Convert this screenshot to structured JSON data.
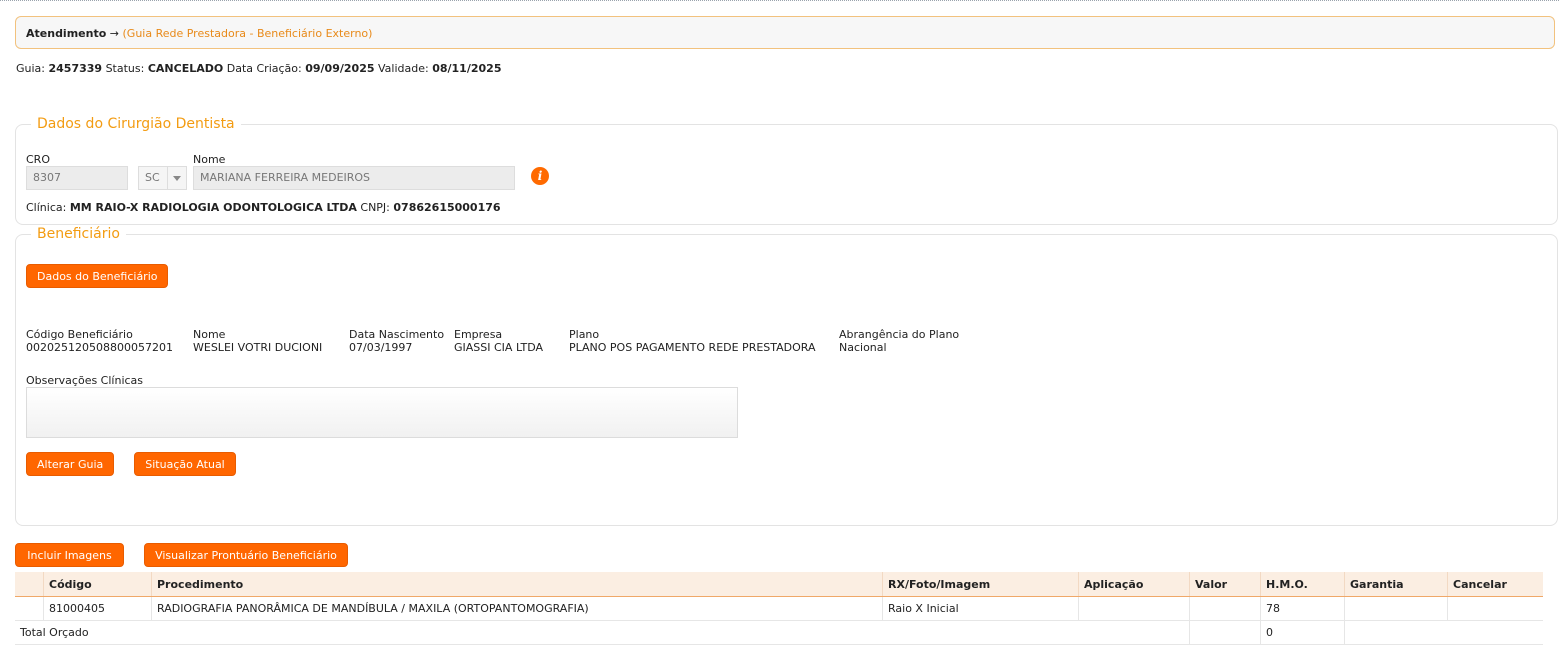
{
  "breadcrumb": {
    "section": "Atendimento",
    "arrow": "→",
    "current": "(Guia Rede Prestadora - Beneficiário Externo)"
  },
  "guia": {
    "guia_label": "Guia:",
    "guia_value": "2457339",
    "status_label": "Status:",
    "status_value": "CANCELADO",
    "criacao_label": "Data Criação:",
    "criacao_value": "09/09/2025",
    "validade_label": "Validade:",
    "validade_value": "08/11/2025"
  },
  "dentista": {
    "legend": "Dados do Cirurgião Dentista",
    "cro_label": "CRO",
    "cro_value": "8307",
    "uf_value": "SC",
    "nome_label": "Nome",
    "nome_value": "MARIANA FERREIRA MEDEIROS",
    "info_icon": "i",
    "clinica_label": "Clínica:",
    "clinica_value": "MM RAIO-X RADIOLOGIA ODONTOLOGICA LTDA",
    "cnpj_label": "CNPJ:",
    "cnpj_value": "07862615000176"
  },
  "beneficiario": {
    "legend": "Beneficiário",
    "dados_button": "Dados do Beneficiário",
    "codigo_label": "Código Beneficiário",
    "codigo_value": "002025120508800057201",
    "nome_label": "Nome",
    "nome_value": "WESLEI VOTRI DUCIONI",
    "nascimento_label": "Data Nascimento",
    "nascimento_value": "07/03/1997",
    "empresa_label": "Empresa",
    "empresa_value": "GIASSI CIA LTDA",
    "plano_label": "Plano",
    "plano_value": "PLANO POS PAGAMENTO REDE PRESTADORA",
    "abrangencia_label": "Abrangência do Plano",
    "abrangencia_value": "Nacional",
    "observacoes_label": "Observações Clínicas",
    "observacoes_value": "",
    "alterar_button": "Alterar Guia",
    "situacao_button": "Situação Atual"
  },
  "actions": {
    "incluir_button": "Incluir Imagens",
    "prontuario_button": "Visualizar Prontuário Beneficiário"
  },
  "table": {
    "headers": [
      "",
      "Código",
      "Procedimento",
      "RX/Foto/Imagem",
      "Aplicação",
      "Valor",
      "H.M.O.",
      "Garantia",
      "Cancelar"
    ],
    "rows": [
      {
        "check": "",
        "codigo": "81000405",
        "procedimento": "RADIOGRAFIA PANORÂMICA DE MANDÍBULA / MAXILA (ORTOPANTOMOGRAFIA)",
        "rx": "Raio X Inicial",
        "aplicacao": "",
        "valor": "",
        "hmo": "78",
        "garantia": "",
        "cancelar": ""
      }
    ],
    "total_label": "Total Orçado",
    "total_valor": "",
    "total_hmo": "0"
  },
  "colors": {
    "accent": "#ff6600",
    "legend": "#f39c12",
    "table_header_bg": "#fbeee2"
  }
}
